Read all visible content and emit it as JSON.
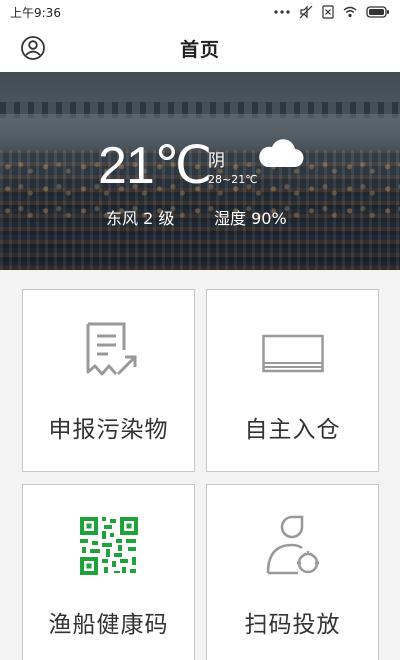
{
  "status_bar": {
    "time": "上午9:36",
    "icons": [
      "more-dots-icon",
      "mute-icon",
      "no-sim-icon",
      "wifi-icon",
      "battery-icon"
    ]
  },
  "header": {
    "title": "首页",
    "left_icon": "user-icon"
  },
  "weather": {
    "temperature": "21℃",
    "condition": "阴",
    "range": "28~21℃",
    "condition_icon": "cloud-icon",
    "wind": "东风 2 级",
    "humidity": "湿度 90%"
  },
  "tiles": [
    {
      "label": "申报污染物",
      "icon": "report-document-icon",
      "color": "#9a9a9a"
    },
    {
      "label": "自主入仓",
      "icon": "warehouse-icon",
      "color": "#9a9a9a"
    },
    {
      "label": "渔船健康码",
      "icon": "qr-code-icon",
      "color": "#22a23c"
    },
    {
      "label": "扫码投放",
      "icon": "user-drop-icon",
      "color": "#9a9a9a"
    }
  ]
}
